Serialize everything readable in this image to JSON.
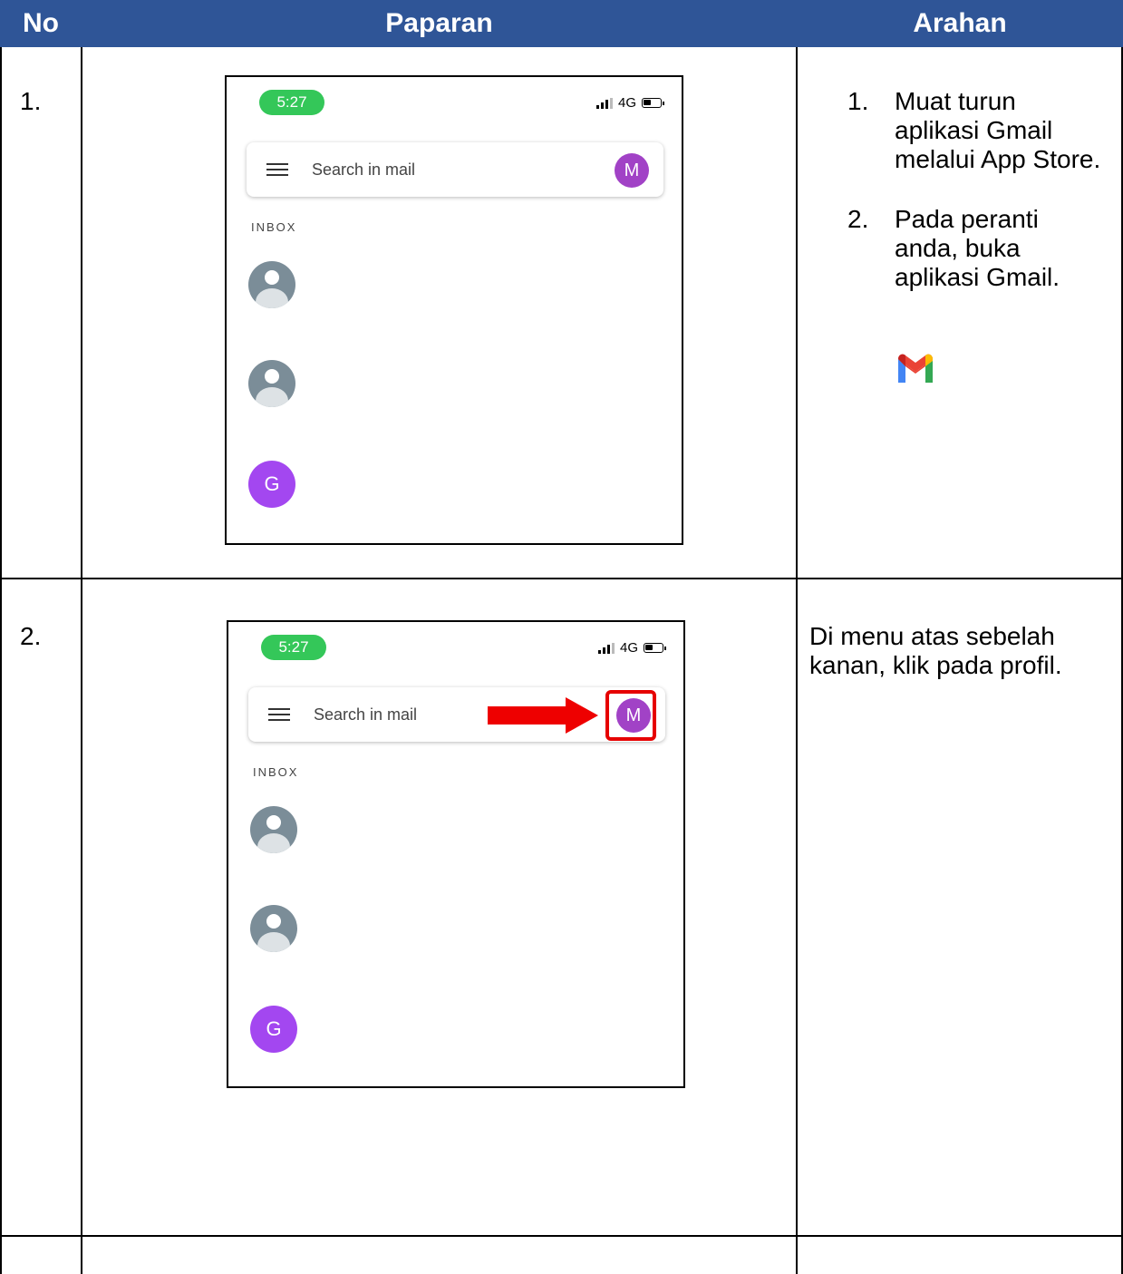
{
  "header": {
    "col_no": "No",
    "col_display": "Paparan",
    "col_instruction": "Arahan"
  },
  "colors": {
    "header_bg": "#2f5597",
    "status_pill": "#34c759",
    "profile_avatar": "#a142c6",
    "g_avatar": "#a347f0",
    "highlight": "#e60000"
  },
  "rows": [
    {
      "number": "1.",
      "phone": {
        "time": "5:27",
        "network": "4G",
        "search_placeholder": "Search in mail",
        "avatar_initial": "M",
        "section_label": "INBOX",
        "contact_initial": "G"
      },
      "instructions": [
        {
          "n": "1.",
          "text": "Muat turun aplikasi Gmail melalui App Store."
        },
        {
          "n": "2.",
          "text": "Pada peranti anda, buka aplikasi Gmail."
        }
      ],
      "icon": "gmail-icon"
    },
    {
      "number": "2.",
      "phone": {
        "time": "5:27",
        "network": "4G",
        "search_placeholder": "Search in mail",
        "avatar_initial": "M",
        "section_label": "INBOX",
        "contact_initial": "G"
      },
      "instruction_text": "Di menu atas sebelah kanan, klik pada profil.",
      "annotation": [
        "red-arrow-icon",
        "highlight-box"
      ]
    }
  ]
}
